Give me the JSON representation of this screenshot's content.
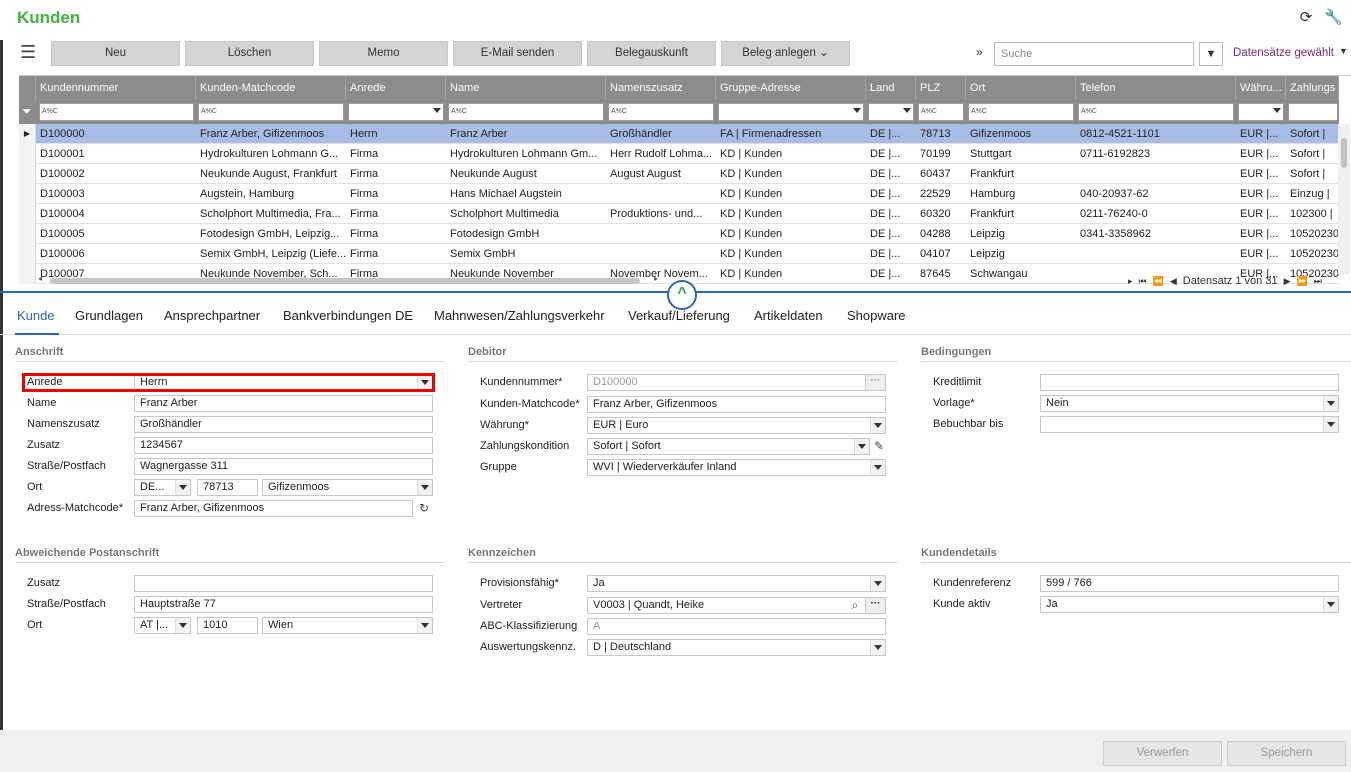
{
  "app": {
    "title": "Kunden"
  },
  "toolbar": {
    "buttons": [
      "Neu",
      "Löschen",
      "Memo",
      "E-Mail senden",
      "Belegauskunft",
      "Beleg anlegen"
    ],
    "search_placeholder": "Suche",
    "records_label": "Datensätze gewählt"
  },
  "grid": {
    "columns": [
      "Kundennummer",
      "Kunden-Matchcode",
      "Anrede",
      "Name",
      "Namenszusatz",
      "Gruppe-Adresse",
      "Land",
      "PLZ",
      "Ort",
      "Telefon",
      "Währu...",
      "Zahlungs"
    ],
    "filter_hint": "A%C",
    "rows": [
      [
        "D100000",
        "Franz Arber, Gifizenmoos",
        "Herrn",
        "Franz Arber",
        "Großhändler",
        "FA  |  Firmenadressen",
        "DE |...",
        "78713",
        "Gifizenmoos",
        "0812-4521-1101",
        "EUR  |...",
        "Sofort  |"
      ],
      [
        "D100001",
        "Hydrokulturen Lohmann G...",
        "Firma",
        "Hydrokulturen Lohmann Gm...",
        "Herr Rudolf Lohma...",
        "KD  |  Kunden",
        "DE |...",
        "70199",
        "Stuttgart",
        "0711-6192823",
        "EUR  |...",
        "Sofort  |"
      ],
      [
        "D100002",
        "Neukunde August, Frankfurt",
        "Firma",
        "Neukunde August",
        "August August",
        "KD  |  Kunden",
        "DE |...",
        "60437",
        "Frankfurt",
        "",
        "EUR  |...",
        "Sofort  |"
      ],
      [
        "D100003",
        "Augstein, Hamburg",
        "Firma",
        "Hans Michael Augstein",
        "",
        "KD  |  Kunden",
        "DE |...",
        "22529",
        "Hamburg",
        "040-20937-62",
        "EUR  |...",
        "Einzug  |"
      ],
      [
        "D100004",
        "Scholphort Multimedia, Fra...",
        "Firma",
        "Scholphort Multimedia",
        "Produktions- und...",
        "KD  |  Kunden",
        "DE |...",
        "60320",
        "Frankfurt",
        "0211-76240-0",
        "EUR  |...",
        "102300  |"
      ],
      [
        "D100005",
        "Fotodesign GmbH, Leipzig...",
        "Firma",
        "Fotodesign GmbH",
        "",
        "KD  |  Kunden",
        "DE |...",
        "04288",
        "Leipzig",
        "0341-3358962",
        "EUR  |...",
        "10520230"
      ],
      [
        "D100006",
        "Semix GmbH, Leipzig (Liefe...",
        "Firma",
        "Semix GmbH",
        "",
        "KD  |  Kunden",
        "DE |...",
        "04107",
        "Leipzig",
        "",
        "EUR  |...",
        "10520230"
      ],
      [
        "D100007",
        "Neukunde November, Sch...",
        "Firma",
        "Neukunde November",
        "November Novem...",
        "KD  |  Kunden",
        "DE |...",
        "87645",
        "Schwangau",
        "",
        "EUR  |...",
        "10520230"
      ]
    ],
    "pager": "Datensatz 1 von 31"
  },
  "tabs": [
    "Kunde",
    "Grundlagen",
    "Ansprechpartner",
    "Bankverbindungen DE",
    "Mahnwesen/Zahlungsverkehr",
    "Verkauf/Lieferung",
    "Artikeldaten",
    "Shopware"
  ],
  "anschrift": {
    "title": "Anschrift",
    "anrede_label": "Anrede",
    "anrede": "Herrn",
    "name_label": "Name",
    "name": "Franz Arber",
    "namenszusatz_label": "Namenszusatz",
    "namenszusatz": "Großhändler",
    "zusatz_label": "Zusatz",
    "zusatz": "1234567",
    "strasse_label": "Straße/Postfach",
    "strasse": "Wagnergasse 311",
    "ort_label": "Ort",
    "land": "DE...",
    "plz": "78713",
    "ort": "Gifizenmoos",
    "adress_match_label": "Adress-Matchcode*",
    "adress_match": "Franz Arber, Gifizenmoos"
  },
  "debitor": {
    "title": "Debitor",
    "kundennummer_label": "Kundennummer*",
    "kundennummer": "D100000",
    "matchcode_label": "Kunden-Matchcode*",
    "matchcode": "Franz Arber, Gifizenmoos",
    "waehrung_label": "Währung*",
    "waehrung": "EUR  |  Euro",
    "zahlung_label": "Zahlungskondition",
    "zahlung": "Sofort  |  Sofort",
    "gruppe_label": "Gruppe",
    "gruppe": "WVI  |  Wiederverkäufer Inland"
  },
  "bedingungen": {
    "title": "Bedingungen",
    "kreditlimit_label": "Kreditlimit",
    "kreditlimit": "",
    "vorlage_label": "Vorlage*",
    "vorlage": "Nein",
    "bebuchbar_label": "Bebuchbar bis",
    "bebuchbar": ""
  },
  "abweichende": {
    "title": "Abweichende Postanschrift",
    "zusatz_label": "Zusatz",
    "zusatz": "",
    "strasse_label": "Straße/Postfach",
    "strasse": "Hauptstraße 77",
    "ort_label": "Ort",
    "land": "AT  |...",
    "plz": "1010",
    "ort": "Wien"
  },
  "kennzeichen": {
    "title": "Kennzeichen",
    "provision_label": "Provisionsfähig*",
    "provision": "Ja",
    "vertreter_label": "Vertreter",
    "vertreter": "V0003  |  Quandt, Heike",
    "abc_label": "ABC-Klassifizierung",
    "abc": "A",
    "auswertung_label": "Auswertungskennz.",
    "auswertung": "D  |  Deutschland"
  },
  "kundendetails": {
    "title": "Kundendetails",
    "referenz_label": "Kundenreferenz",
    "referenz": "599 / 766",
    "aktiv_label": "Kunde aktiv",
    "aktiv": "Ja"
  },
  "footer": {
    "discard": "Verwerfen",
    "save": "Speichern"
  },
  "colors": {
    "title_green": "#3fb53f",
    "accent_blue": "#2a67b8",
    "selected_row": "#a8bde6",
    "highlight_red": "#e00000"
  }
}
